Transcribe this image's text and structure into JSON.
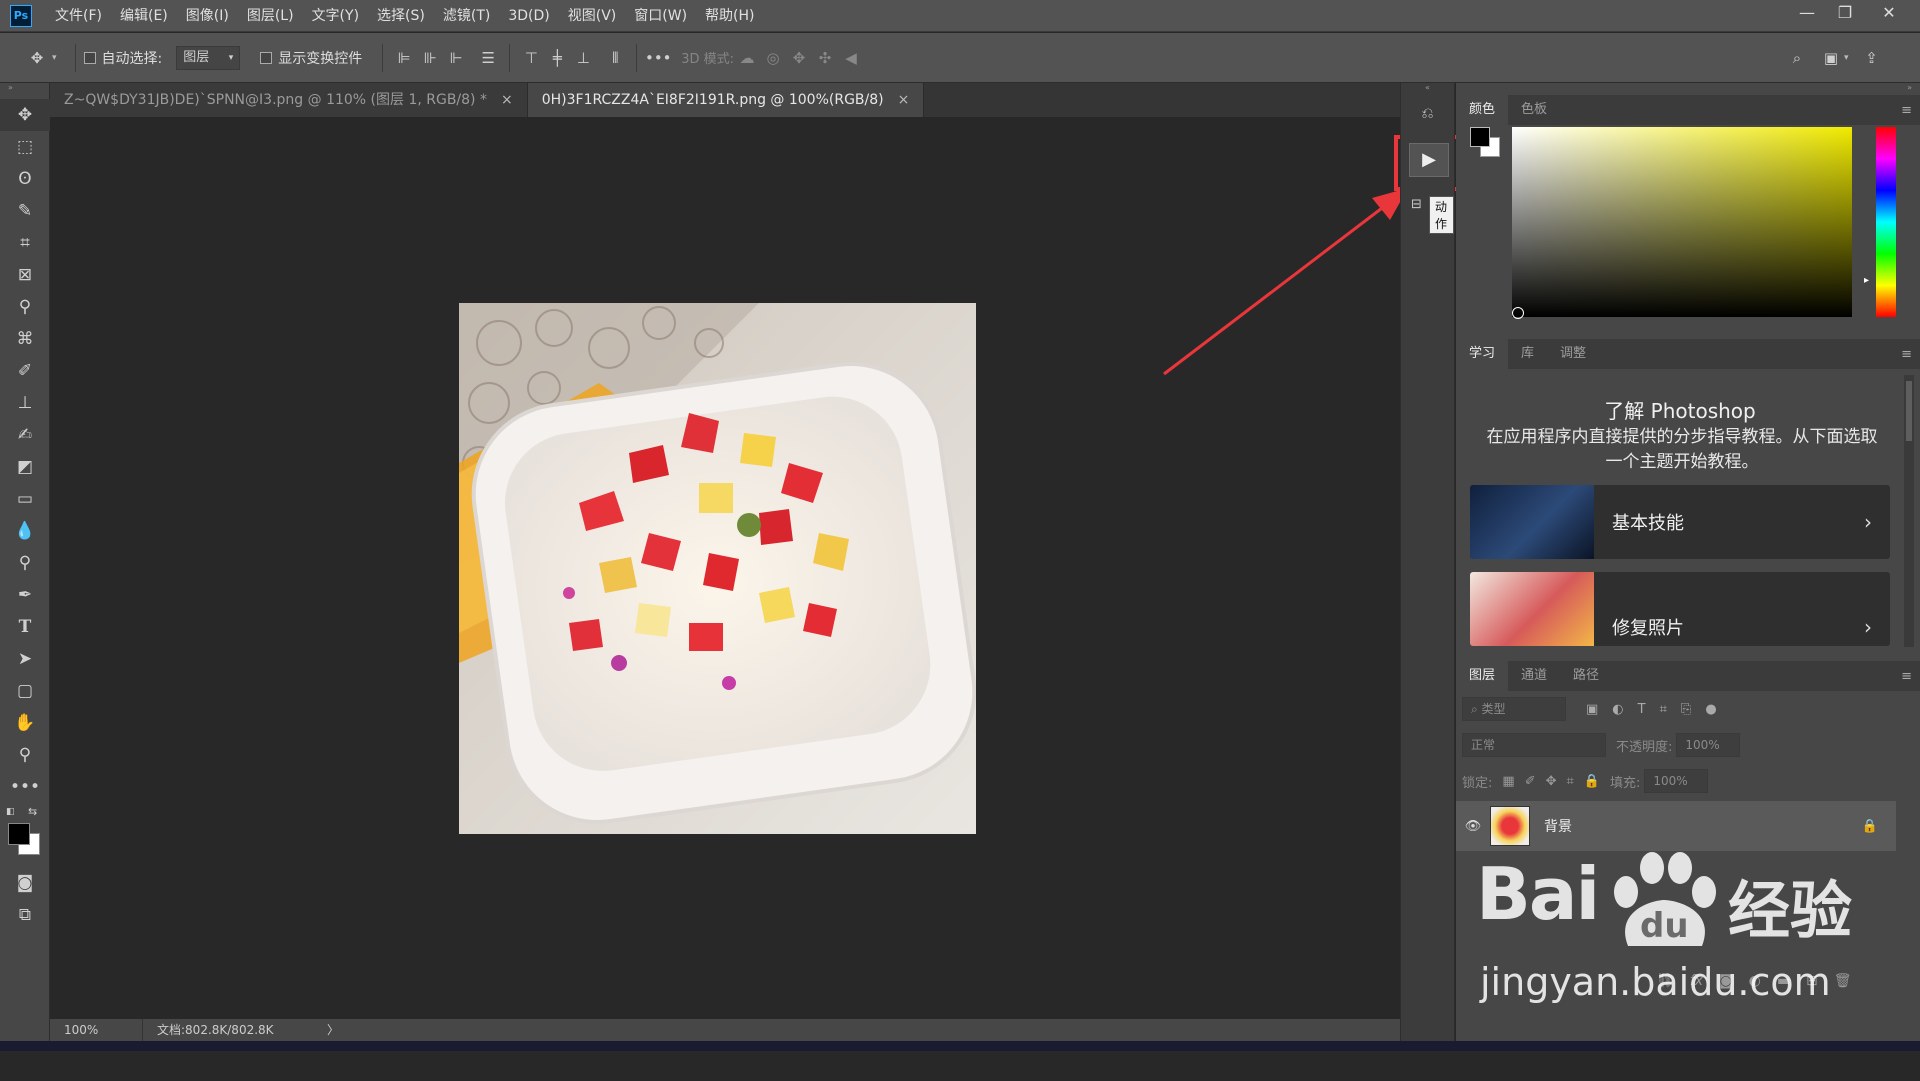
{
  "app": {
    "logo": "Ps"
  },
  "menu": [
    "文件(F)",
    "编辑(E)",
    "图像(I)",
    "图层(L)",
    "文字(Y)",
    "选择(S)",
    "滤镜(T)",
    "3D(D)",
    "视图(V)",
    "窗口(W)",
    "帮助(H)"
  ],
  "window_controls": [
    "minimize-icon",
    "restore-icon",
    "close-icon"
  ],
  "options": {
    "auto_select_label": "自动选择:",
    "auto_select_value": "图层",
    "show_transform_label": "显示变换控件",
    "mode3d_label": "3D 模式:"
  },
  "tabs": [
    {
      "label": "Z~QW$DY31JB)DE)`SPNN@I3.png @ 110% (图层 1, RGB/8) *",
      "close": "×"
    },
    {
      "label": "0H)3F1RCZZ4A`EI8F2I191R.png @ 100%(RGB/8)",
      "close": "×"
    }
  ],
  "status": {
    "zoom": "100%",
    "doc": "文档:802.8K/802.8K",
    "arrow": "〉"
  },
  "tooltip": "动作",
  "color_panel": {
    "tabs": [
      "颜色",
      "色板"
    ],
    "fg": "#000000",
    "bg": "#ffffff",
    "hue": "#f0ea00"
  },
  "learn_panel": {
    "tabs": [
      "学习",
      "库",
      "调整"
    ],
    "title": "了解 Photoshop",
    "desc": "在应用程序内直接提供的分步指导教程。从下面选取一个主题开始教程。",
    "cards": [
      {
        "label": "基本技能"
      },
      {
        "label": "修复照片"
      }
    ]
  },
  "layers_panel": {
    "tabs": [
      "图层",
      "通道",
      "路径"
    ],
    "filter_placeholder": "类型",
    "blend_mode": "正常",
    "opacity_label": "不透明度:",
    "opacity_value": "100%",
    "lock_label": "锁定:",
    "fill_label": "填充:",
    "fill_value": "100%",
    "layers": [
      {
        "name": "背景"
      }
    ]
  },
  "watermark": {
    "brand": "Bai",
    "paw_text": "du",
    "cn": "经验",
    "url": "jingyan.baidu.com"
  },
  "colors": {
    "accent_red": "#e8363b",
    "panel": "#474747",
    "canvas_bg": "#282828"
  }
}
